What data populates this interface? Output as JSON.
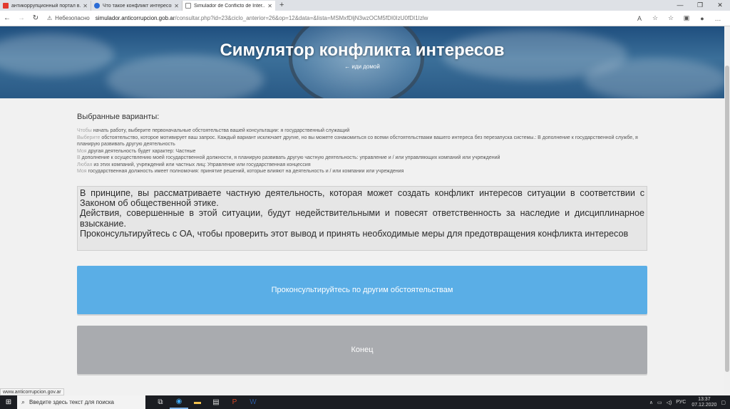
{
  "browser": {
    "tabs": [
      {
        "title": "антикоррупционный портал в...",
        "favicon_color": "#e23a2e",
        "active": false
      },
      {
        "title": "Что такое конфликт интересов...",
        "favicon_color": "#2b6cd6",
        "active": false
      },
      {
        "title": "Simulador de Conflicto de Inter...",
        "favicon_color": "#888888",
        "active": true
      }
    ],
    "new_tab": "+",
    "insecure_label": "Небезопасно",
    "url_host": "simulador.anticorrupcion.gob.ar",
    "url_rest": "/consultar.php?id=23&ciclo_anterior=26&op=12&data=&lista=MSMxfDljN3wzOCM5fDI0IzU0fDI1Izlw"
  },
  "hero": {
    "title": "Симулятор конфликта интересов",
    "home_link": "← иди домой"
  },
  "selected": {
    "title": "Выбранные варианты:",
    "options": [
      {
        "q": "Чтобы",
        "a": "начать работу, выберите первоначальные обстоятельства вашей консультации: я государственный служащий"
      },
      {
        "q": "Выберите",
        "a": "обстоятельство, которое мотивирует ваш запрос. Каждый вариант исключает другие, но вы можете ознакомиться со всеми обстоятельствами вашего интереса без перезапуска системы.: В дополнение к государственной службе, я планирую развивать другую деятельность"
      },
      {
        "q": "Моя",
        "a": "другая деятельность будет характер: Частные"
      },
      {
        "q": "В",
        "a": "дополнение к осуществлению моей государственной должности, я планирую развивать другую частную деятельность: управление и / или управляющих компаний или учреждений"
      },
      {
        "q": "Любая",
        "a": "из этих компаний, учреждений или частных лиц: Управление или государственная концессия"
      },
      {
        "q": "Моя",
        "a": "государственная должность имеет полномочия: принятие решений, которые влияют на деятельность и / или компании или учреждения"
      }
    ]
  },
  "result": {
    "p1": "В принципе, вы рассматриваете частную деятельность, которая может создать конфликт интересов ситуации в соответствии с Законом об общественной этике.",
    "p2": "Действия, совершенные в этой ситуации, будут недействительными и повесят ответственность за наследие и дисциплинарное взыскание.",
    "p3": "Проконсультируйтесь с ОА, чтобы проверить этот вывод и принять необходимые меры для предотвращения конфликта интересов"
  },
  "buttons": {
    "consult_other": "Проконсультируйтесь по другим обстоятельствам",
    "end": "Конец"
  },
  "status_link": "www.anticorrupcion.gov.ar",
  "taskbar": {
    "search_placeholder": "Введите здесь текст для поиска",
    "lang": "РУС",
    "time": "13:37",
    "date": "07.12.2020"
  }
}
